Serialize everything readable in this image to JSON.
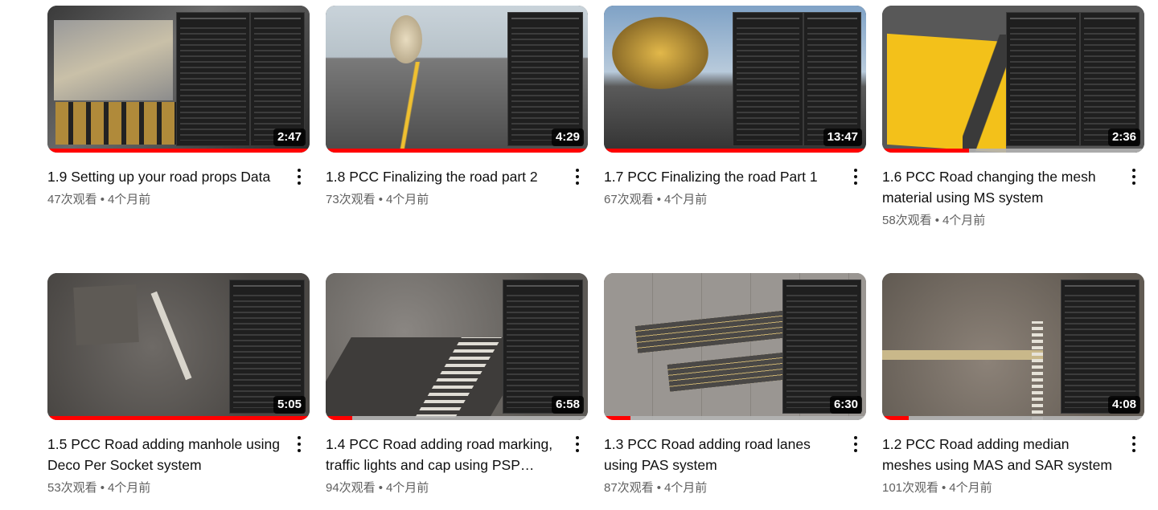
{
  "videos": [
    {
      "title": "1.9 Setting up your road props Data",
      "duration": "2:47",
      "views": "47次观看",
      "age": "4个月前",
      "progress": 1.0
    },
    {
      "title": "1.8 PCC Finalizing the road part 2",
      "duration": "4:29",
      "views": "73次观看",
      "age": "4个月前",
      "progress": 1.0
    },
    {
      "title": "1.7 PCC Finalizing the road Part 1",
      "duration": "13:47",
      "views": "67次观看",
      "age": "4个月前",
      "progress": 1.0
    },
    {
      "title": "1.6 PCC Road changing the mesh material using MS system",
      "duration": "2:36",
      "views": "58次观看",
      "age": "4个月前",
      "progress": 0.33
    },
    {
      "title": "1.5 PCC Road adding manhole using Deco Per Socket system",
      "duration": "5:05",
      "views": "53次观看",
      "age": "4个月前",
      "progress": 1.0
    },
    {
      "title": "1.4 PCC Road adding road marking, traffic lights and cap using PSP…",
      "duration": "6:58",
      "views": "94次观看",
      "age": "4个月前",
      "progress": 0.1
    },
    {
      "title": "1.3 PCC Road adding road lanes using PAS system",
      "duration": "6:30",
      "views": "87次观看",
      "age": "4个月前",
      "progress": 0.1
    },
    {
      "title": "1.2 PCC Road adding median meshes using MAS and SAR system",
      "duration": "4:08",
      "views": "101次观看",
      "age": "4个月前",
      "progress": 0.1
    }
  ],
  "separator": "•",
  "colors": {
    "progress": "#ff0000",
    "track": "#b4b4b4",
    "meta_text": "#606060"
  }
}
